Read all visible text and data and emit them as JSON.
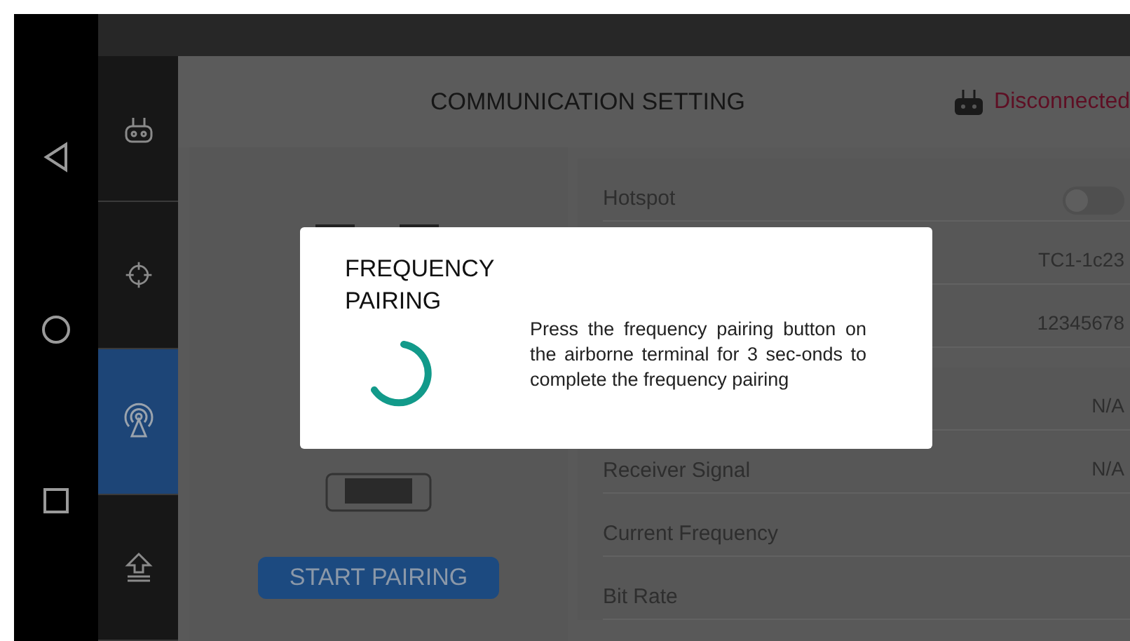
{
  "sidebar": {
    "items": [
      {
        "kind": "controller",
        "selected": false
      },
      {
        "kind": "crosshair",
        "selected": false
      },
      {
        "kind": "signal",
        "selected": true
      },
      {
        "kind": "upload",
        "selected": false
      }
    ]
  },
  "header": {
    "title": "COMMUNICATION SETTING",
    "status": "Disconnected"
  },
  "pairing_button": "START PAIRING",
  "sections": [
    [
      {
        "kind": "toggle",
        "label": "Hotspot",
        "on": false
      },
      {
        "kind": "value",
        "value": "TC1-1c23"
      },
      {
        "kind": "value",
        "value": "12345678"
      }
    ],
    [
      {
        "kind": "value",
        "value": "N/A"
      },
      {
        "kind": "value",
        "label": "Receiver Signal",
        "value": "N/A"
      },
      {
        "kind": "value",
        "label": "Current Frequency"
      },
      {
        "kind": "value",
        "label": "Bit Rate"
      }
    ]
  ],
  "dialog": {
    "title": "FREQUENCY PAIRING",
    "message": "Press the frequency pairing button on the airborne terminal for 3 sec-onds to complete the frequency pairing"
  }
}
